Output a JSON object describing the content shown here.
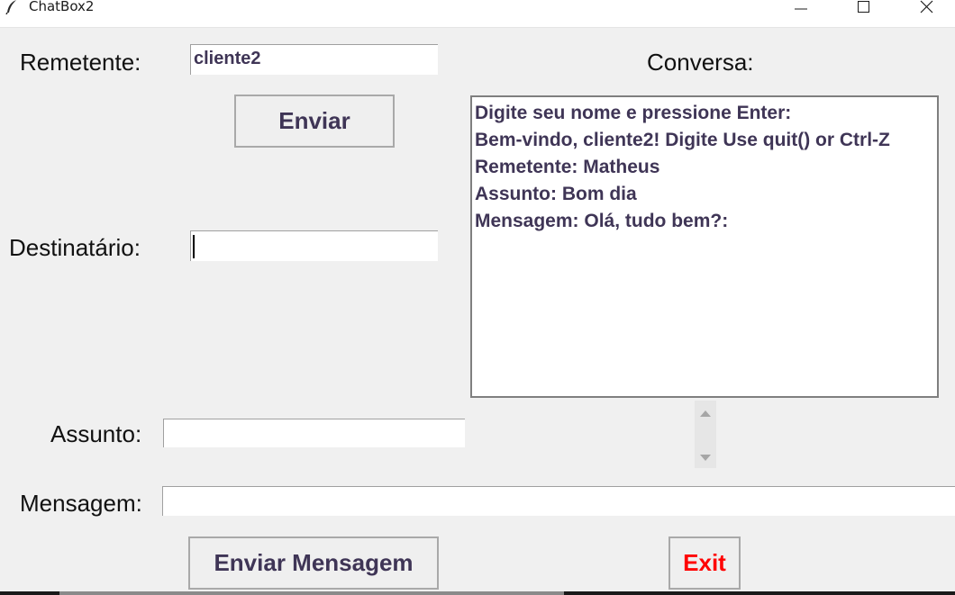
{
  "window": {
    "title": "ChatBox2",
    "icon": "feather-icon"
  },
  "form": {
    "remetente_label": "Remetente:",
    "remetente_value": "cliente2",
    "enviar_label": "Enviar",
    "destinatario_label": "Destinatário:",
    "destinatario_value": "",
    "assunto_label": "Assunto:",
    "assunto_value": "",
    "mensagem_label": "Mensagem:",
    "mensagem_value": "",
    "enviar_mensagem_label": "Enviar Mensagem",
    "exit_label": "Exit"
  },
  "conversa": {
    "label": "Conversa:",
    "lines": [
      "Digite seu nome e pressione Enter:",
      "Bem-vindo, cliente2! Digite Use quit() or Ctrl-Z",
      "Remetente: Matheus",
      "Assunto: Bom dia",
      "Mensagem: Olá, tudo bem?:"
    ]
  },
  "colors": {
    "entry_text": "#3f3556",
    "exit_text": "#ff0000",
    "background": "#f0f0f0"
  }
}
